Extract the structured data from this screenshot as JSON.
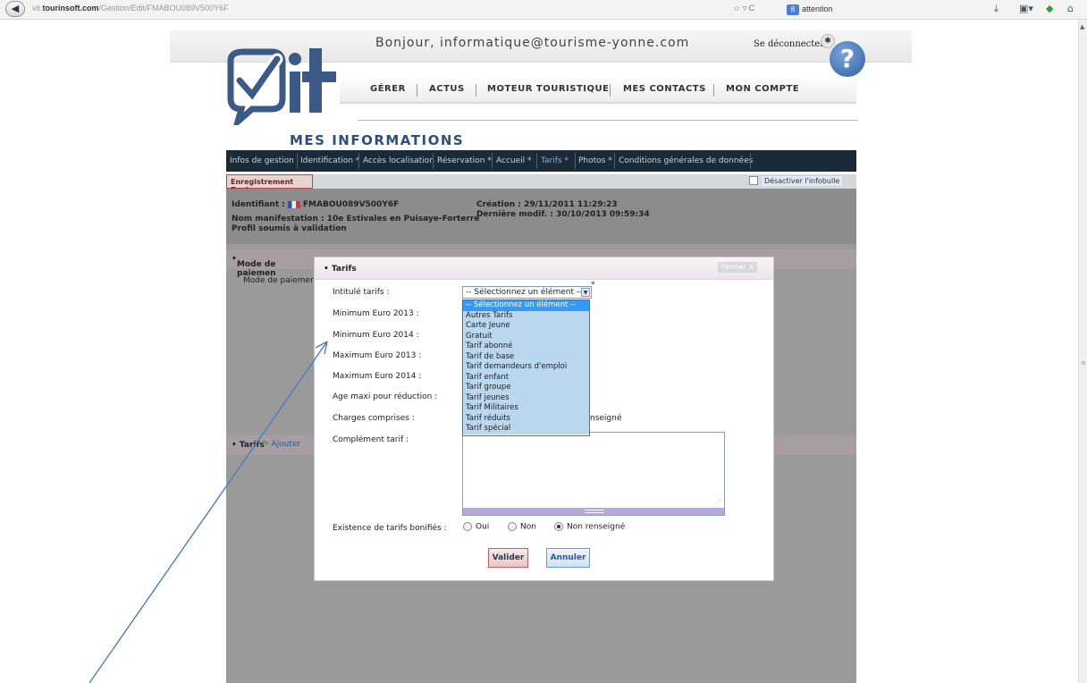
{
  "browser": {
    "url_prefix": "vit.",
    "url_domain": "tourinsoft.com",
    "url_path": "/Gestion/Edit/FMABOU089V500Y6F",
    "search_text": "attention"
  },
  "header": {
    "greeting": "Bonjour, informatique@tourisme-yonne.com",
    "logout": "Se déconnecter",
    "help": "?",
    "logo_text": "vit"
  },
  "nav": {
    "items": [
      "GÉRER",
      "ACTUS",
      "MOTEUR TOURISTIQUE",
      "MES CONTACTS",
      "MON COMPTE"
    ]
  },
  "section_title": "MES INFORMATIONS",
  "tabs": [
    {
      "label": "Infos de gestion"
    },
    {
      "label": "Identification *"
    },
    {
      "label": "Accès localisation"
    },
    {
      "label": "Réservation *"
    },
    {
      "label": "Accueil *"
    },
    {
      "label": "Tarifs *"
    },
    {
      "label": "Photos *"
    },
    {
      "label": "Conditions générales de données"
    }
  ],
  "subbar": {
    "final_button": "Enregistrement final",
    "infobulle": "Désactiver l'infobulle"
  },
  "record": {
    "identifiant_label": "Identifiant :",
    "identifiant": "FMABOU089V500Y6F",
    "nom": "Nom manifestation : 10e Estivales en Puisaye-Forterre",
    "profil": "Profil soumis à validation",
    "creation": "Création : 29/11/2011 11:29:23",
    "modif": "Dernière modif. : 30/10/2013 09:59:34"
  },
  "sections": {
    "paiement": "Mode de paiemen",
    "paiement_sub": "Mode de paiement",
    "tarifs": "Tarifs",
    "ajouter": "Ajouter"
  },
  "modal": {
    "title": "Tarifs",
    "close": "Fermer X",
    "labels": {
      "intitule": "Intitulé tarifs :",
      "min2013": "Minimum Euro 2013 :",
      "min2014": "Minimum Euro 2014 :",
      "max2013": "Maximum Euro 2013 :",
      "max2014": "Maximum Euro 2014 :",
      "age": "Age maxi pour réduction :",
      "charges": "Charges comprises :",
      "complement": "Complément tarif :",
      "bonifies": "Existence de tarifs bonifiés :"
    },
    "select_value": "-- Sélectionnez un élément --",
    "asterisk": "*",
    "charges_behind": "nseigné",
    "dropdown_options": [
      "-- Sélectionnez un élément --",
      "Autres Tarifs",
      "Carte Jeune",
      "Gratuit",
      "Tarif abonné",
      "Tarif de base",
      "Tarif demandeurs d'emploi",
      "Tarif enfant",
      "Tarif groupe",
      "Tarif jeunes",
      "Tarif Militaires",
      "Tarif réduits",
      "Tarif spécial"
    ],
    "radio": {
      "oui": "Oui",
      "non": "Non",
      "nr": "Non renseigné"
    },
    "buttons": {
      "valider": "Valider",
      "annuler": "Annuler"
    }
  },
  "colors": {
    "tabbar": "#1a2b37",
    "accent_blue": "#2d4e7e",
    "dropdown_highlight": "#3399ff",
    "arrow": "#4a7fc0"
  }
}
